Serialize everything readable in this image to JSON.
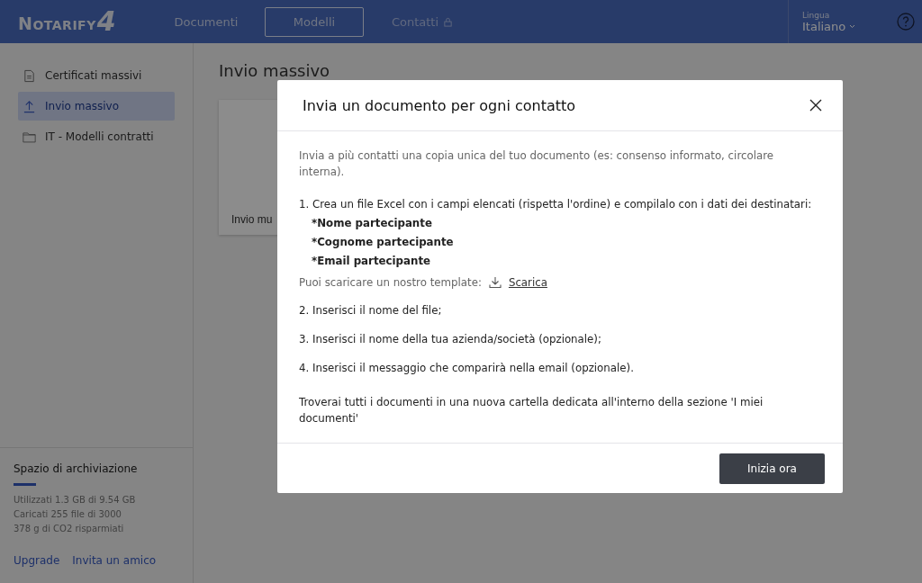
{
  "header": {
    "logo": {
      "text": "NOTARIFY",
      "mark": "4"
    },
    "nav": [
      {
        "label": "Documenti",
        "selected": false,
        "locked": false
      },
      {
        "label": "Modelli",
        "selected": true,
        "locked": false
      },
      {
        "label": "Contatti",
        "selected": false,
        "locked": true
      }
    ],
    "language": {
      "label": "Lingua",
      "value": "Italiano"
    }
  },
  "sidebar": {
    "items": [
      {
        "label": "Certificati massivi",
        "kind": "document",
        "selected": false
      },
      {
        "label": "Invio massivo",
        "kind": "upload",
        "selected": true
      },
      {
        "label": "IT - Modelli contratti",
        "kind": "folder",
        "selected": false
      }
    ],
    "storage": {
      "title": "Spazio di archiviazione",
      "level": 0.14,
      "lines": [
        "Utilizzati 1.3 GB di 9.54 GB",
        "Caricati 255 file di 3000",
        "378 g di CO2 risparmiati"
      ],
      "links": [
        "Upgrade",
        "Invita un amico"
      ]
    }
  },
  "main": {
    "title": "Invio massivo",
    "card_label": "Invio mu"
  },
  "dialog": {
    "title": "Invia un documento per ogni contatto",
    "intro": "Invia a più contatti una copia unica del tuo documento (es: consenso informato, circolare interna).",
    "step_1": "1. Crea un file Excel con i campi elencati (rispetta l'ordine) e compilalo con i dati dei destinatari:",
    "fields": [
      "*Nome partecipante",
      "*Cognome partecipante",
      "*Email partecipante"
    ],
    "template": {
      "text": "Puoi scaricare un nostro template:",
      "link": "Scarica"
    },
    "steps": [
      "2. Inserisci il nome del file;",
      "3. Inserisci il nome della tua azienda/società (opzionale);",
      "4. Inserisci il messaggio che comparirà nella email (opzionale)."
    ],
    "note": "Troverai tutti i documenti in una nuova cartella dedicata all'interno della sezione 'I miei documenti'",
    "button": "Inizia ora"
  }
}
